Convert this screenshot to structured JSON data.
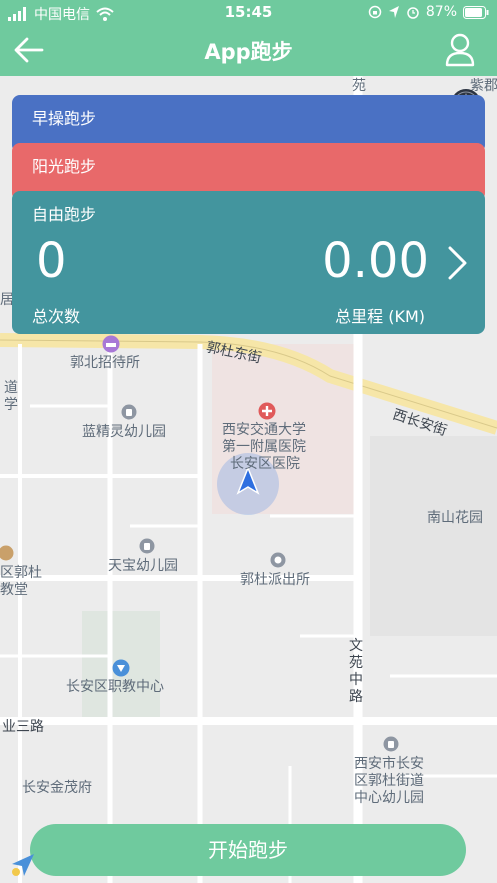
{
  "status_bar": {
    "carrier": "中国电信",
    "time": "15:45",
    "battery": "87%"
  },
  "header": {
    "title": "App跑步",
    "back_icon": "arrow-left-icon",
    "user_icon": "user-icon"
  },
  "cards": {
    "morning": {
      "label": "早操跑步"
    },
    "sunshine": {
      "label": "阳光跑步"
    },
    "free": {
      "label": "自由跑步",
      "count_value": "0",
      "count_label": "总次数",
      "distance_value": "0.00",
      "distance_label": "总里程 (KM)"
    }
  },
  "map": {
    "roads": [
      "郭杜东街",
      "西长安街",
      "文苑中路",
      "业三路"
    ],
    "pois": [
      "郭北招待所",
      "蓝精灵幼儿园",
      "西安交通大学",
      "第一附属医院",
      "长安区医院",
      "南山花园",
      "天宝幼儿园",
      "郭杜派出所",
      "区郭杜",
      "教堂",
      "长安区职教中心",
      "长安金茂府",
      "西安市长安",
      "区郭杜街道",
      "中心幼儿园",
      "紫郡",
      "苑",
      "居",
      "道",
      "学"
    ]
  },
  "colors": {
    "header": "#6fca9e",
    "morning": "#4a71c4",
    "sunshine": "#e8696a",
    "free": "#43959e"
  },
  "start_button": {
    "label": "开始跑步"
  }
}
